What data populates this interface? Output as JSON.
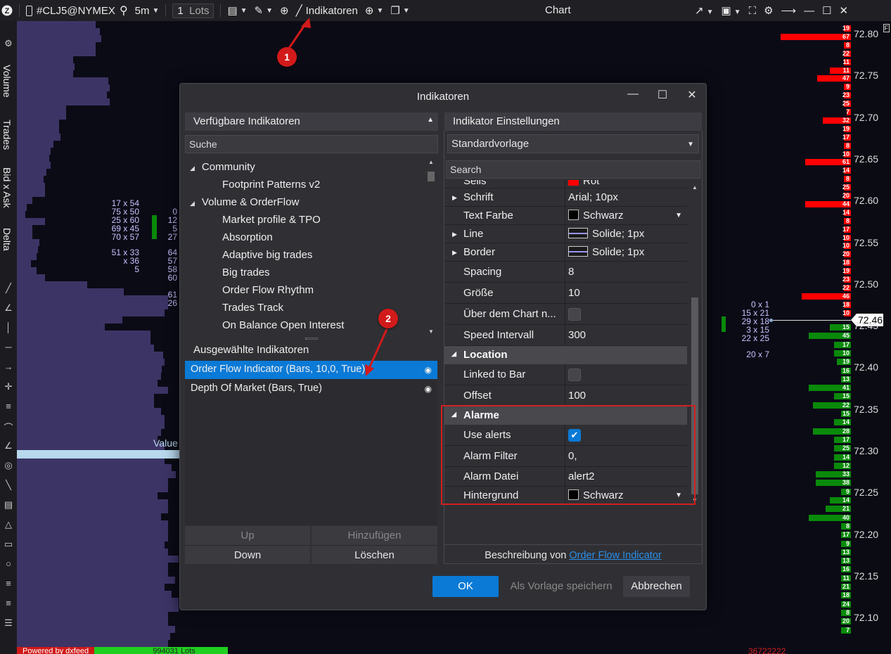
{
  "toolbar": {
    "symbol": "#CLJ5@NYMEX",
    "timeframe": "5m",
    "lots_value": "1",
    "lots_label": "Lots",
    "indicators_label": "Indikatoren",
    "window_title": "Chart"
  },
  "left_panel": {
    "labels": [
      "Volume",
      "Trades",
      "Bid x Ask",
      "Delta"
    ]
  },
  "chart": {
    "value_label": "Value",
    "price_ticks": [
      "72.80",
      "72.75",
      "72.70",
      "72.65",
      "72.60",
      "72.55",
      "72.50",
      "72.45",
      "72.40",
      "72.35",
      "72.30",
      "72.25",
      "72.20",
      "72.15",
      "72.10"
    ],
    "current_price": "72.46",
    "right_bars_top": [
      "19",
      "67",
      "8",
      "22",
      "11",
      "11",
      "47",
      "9",
      "23",
      "25",
      "7",
      "32",
      "19",
      "17",
      "8",
      "10",
      "61",
      "14",
      "8",
      "25",
      "20",
      "44",
      "14",
      "8",
      "17",
      "10",
      "10",
      "20",
      "18",
      "19",
      "23",
      "22",
      "46",
      "18",
      "10"
    ],
    "right_bars_bottom": [
      "15",
      "45",
      "17",
      "10",
      "19",
      "16",
      "13",
      "41",
      "15",
      "22",
      "15",
      "14",
      "28",
      "17",
      "25",
      "14",
      "12",
      "33",
      "38",
      "9",
      "14",
      "21",
      "40",
      "8",
      "17",
      "9",
      "13",
      "13",
      "16",
      "11",
      "21",
      "18",
      "24",
      "8",
      "20",
      "7"
    ],
    "bid_ask_left": [
      "17 x 54",
      "75 x 50",
      "25 x 60",
      "69 x 45",
      "70 x 57",
      "51 x 33",
      "x 36",
      "5"
    ],
    "delta_left": [
      "0",
      "12",
      "5",
      "27",
      "64",
      "57",
      "58",
      "60",
      "61",
      "26"
    ],
    "bid_ask_right": [
      "0 x 1",
      "15 x 21",
      "29 x 18",
      "3 x 15",
      "22 x 25",
      "20 x 7"
    ],
    "footer_left": "Powered by dxfeed",
    "footer_mid": "994031 Lots",
    "footer_right": "36722222"
  },
  "dialog": {
    "title": "Indikatoren",
    "available_header": "Verfügbare Indikatoren",
    "search_placeholder": "Suche",
    "tree": [
      {
        "label": "Community",
        "level": 0
      },
      {
        "label": "Footprint Patterns v2",
        "level": 1
      },
      {
        "label": "Volume & OrderFlow",
        "level": 0
      },
      {
        "label": "Market profile & TPO",
        "level": 1
      },
      {
        "label": "Absorption",
        "level": 1
      },
      {
        "label": "Adaptive big trades",
        "level": 1
      },
      {
        "label": "Big trades",
        "level": 1
      },
      {
        "label": "Order Flow Rhythm",
        "level": 1
      },
      {
        "label": "Trades Track",
        "level": 1
      },
      {
        "label": "On Balance Open Interest",
        "level": 1
      }
    ],
    "selected_header": "Ausgewählte Indikatoren",
    "selected": [
      "Order Flow Indicator (Bars, 10,0, True)",
      "Depth Of Market (Bars, True)"
    ],
    "buttons": {
      "up": "Up",
      "add": "Hinzufügen",
      "down": "Down",
      "delete": "Löschen"
    },
    "settings_header": "Indikator Einstellungen",
    "template": "Standardvorlage",
    "settings_search": "Search",
    "properties": {
      "sells": "Sells",
      "sells_value": "Rot",
      "font": "Schrift",
      "font_value": "Arial; 10px",
      "text_color": "Text Farbe",
      "text_color_value": "Schwarz",
      "line": "Line",
      "line_value": "Solide; 1px",
      "border": "Border",
      "border_value": "Solide; 1px",
      "spacing": "Spacing",
      "spacing_value": "8",
      "size": "Größe",
      "size_value": "10",
      "above_chart": "Über dem Chart n...",
      "speed": "Speed Intervall",
      "speed_value": "300",
      "location_cat": "Location",
      "linked": "Linked to Bar",
      "offset": "Offset",
      "offset_value": "100",
      "alarm_cat": "Alarme",
      "use_alerts": "Use alerts",
      "alarm_filter": "Alarm Filter",
      "alarm_filter_value": "0,",
      "alarm_file": "Alarm Datei",
      "alarm_file_value": "alert2",
      "background": "Hintergrund",
      "background_value": "Schwarz"
    },
    "description_prefix": "Beschreibung von",
    "description_link": "Order Flow Indicator",
    "ok": "OK",
    "save_template": "Als Vorlage speichern",
    "cancel": "Abbrechen"
  },
  "annotations": [
    "1",
    "2"
  ],
  "colors": {
    "sell": "#ff0000",
    "buy": "#008800",
    "volume": "#3d3466",
    "accent": "#0a7ad6",
    "highlight_box": "#d32020"
  }
}
